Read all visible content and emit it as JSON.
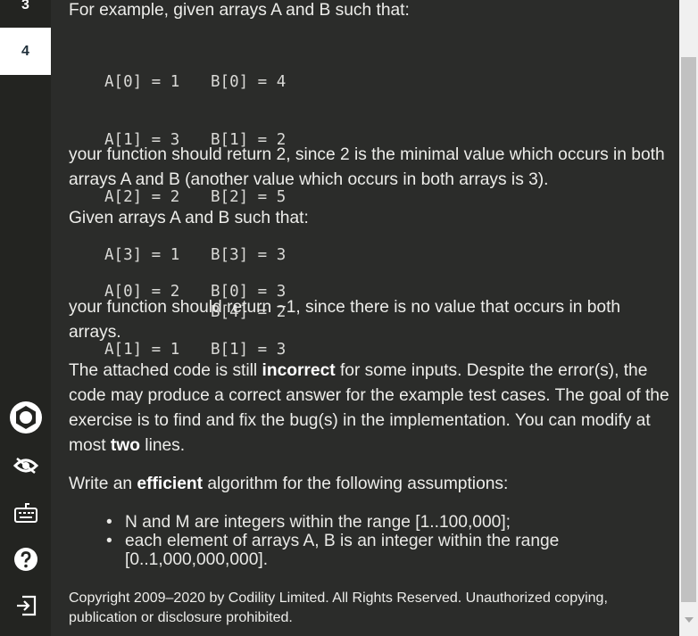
{
  "sidebar": {
    "steps": [
      "3",
      "4"
    ],
    "icons": [
      "settings-icon",
      "visibility-icon",
      "keyboard-icon",
      "help-icon",
      "exit-icon"
    ]
  },
  "content": {
    "example1_intro": "For example, given arrays A and B such that:",
    "example1_a_lines": [
      "A[0] = 1",
      "A[1] = 3",
      "A[2] = 2",
      "A[3] = 1"
    ],
    "example1_b_lines": [
      "B[0] = 4",
      "B[1] = 2",
      "B[2] = 5",
      "B[3] = 3",
      "B[4] = 2"
    ],
    "example1_result": "your function should return 2, since 2 is the minimal value which occurs in both arrays A and B (another value which occurs in both arrays is 3).",
    "example2_intro": "Given arrays A and B such that:",
    "example2_a_lines": [
      "A[0] = 2",
      "A[1] = 1"
    ],
    "example2_b_lines": [
      "B[0] = 3",
      "B[1] = 3"
    ],
    "example2_result": "your function should return −1, since there is no value that occurs in both arrays.",
    "bug_note": {
      "part1": "The attached code is still ",
      "bold1": "incorrect",
      "part2": " for some inputs. Despite the error(s), the code may produce a correct answer for the example test cases. The goal of the exercise is to find and fix the bug(s) in the implementation. You can modify at most ",
      "bold2": "two",
      "part3": " lines."
    },
    "efficiency": {
      "part1": "Write an ",
      "bold": "efficient",
      "part2": " algorithm for the following assumptions:"
    },
    "assumptions": [
      "N and M are integers within the range [1..100,000];",
      "each element of arrays A, B is an integer within the range [0..1,000,000,000]."
    ],
    "copyright": "Copyright 2009–2020 by Codility Limited. All Rights Reserved. Unauthorized copying, publication or disclosure prohibited."
  },
  "colors": {
    "background": "#2b2c2a",
    "sidebar": "#232421",
    "text": "#ededea",
    "active_step_bg": "#ffffff",
    "active_step_text": "#1f2f3a"
  }
}
